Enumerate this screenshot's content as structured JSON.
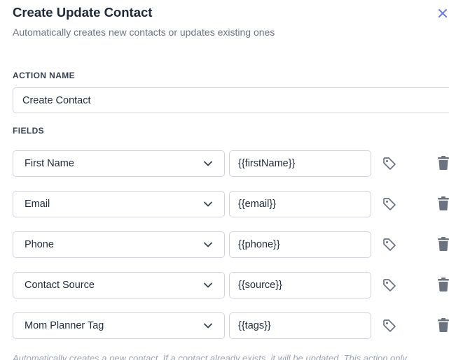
{
  "header": {
    "title": "Create Update Contact",
    "subtitle": "Automatically creates new contacts or updates existing ones"
  },
  "action_name": {
    "label": "ACTION NAME",
    "value": "Create Contact"
  },
  "fields": {
    "label": "FIELDS",
    "rows": [
      {
        "field": "First Name",
        "value": "{{firstName}}"
      },
      {
        "field": "Email",
        "value": "{{email}}"
      },
      {
        "field": "Phone",
        "value": "{{phone}}"
      },
      {
        "field": "Contact Source",
        "value": "{{source}}"
      },
      {
        "field": "Mom Planner Tag",
        "value": "{{tags}}"
      }
    ]
  },
  "footer": {
    "note": "Automatically creates a new contact. If a contact already exists, it will be updated. This action only"
  },
  "icons": {
    "close": "close-icon",
    "select_arrow": "chevron-down-icon",
    "tag": "tag-icon",
    "delete": "trash-icon"
  },
  "colors": {
    "border": "#d1d5db",
    "text": "#1f2937",
    "muted": "#6b7280",
    "icon": "#6b7280",
    "close_accent": "#6b7bd6"
  }
}
